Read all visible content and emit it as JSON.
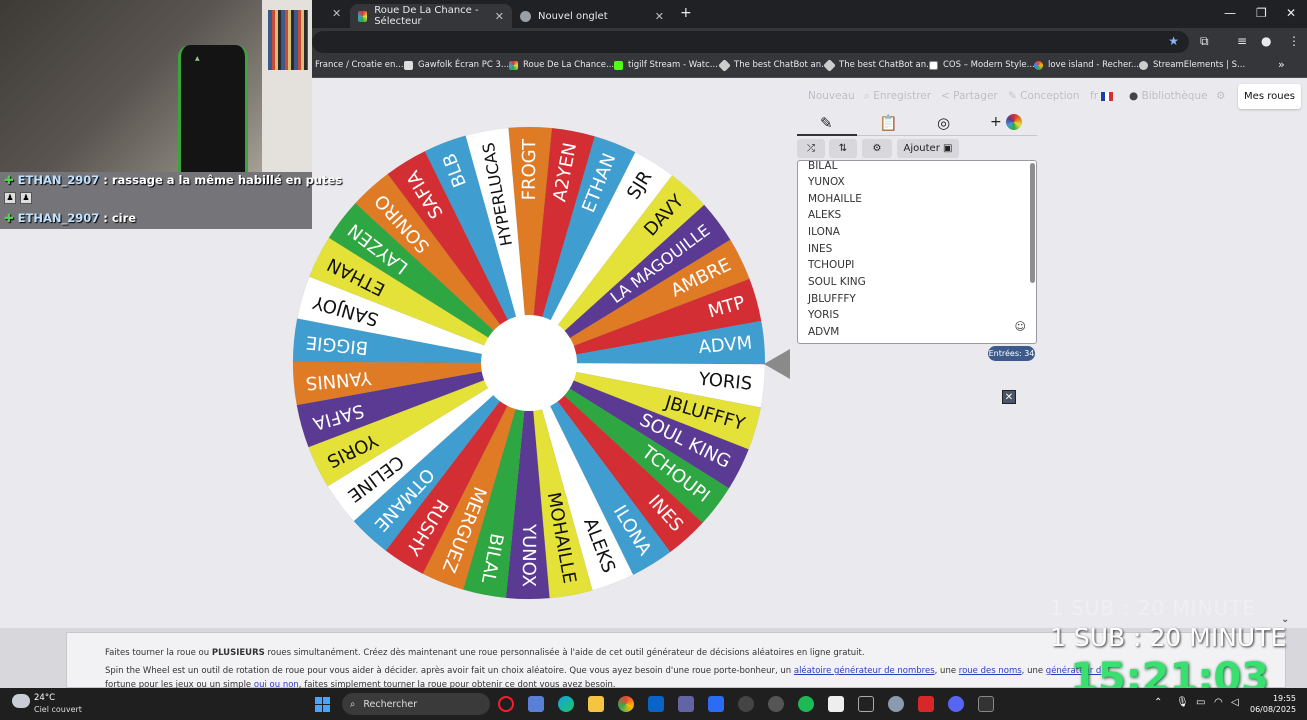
{
  "browser": {
    "tabs": [
      {
        "label": "Roue De La Chance - Sélecteur",
        "active": true
      },
      {
        "label": "Nouvel onglet",
        "active": false
      }
    ],
    "new_tab": "+",
    "bookmarks": [
      "France / Croatie en...",
      "Gawfolk Écran PC 3...",
      "Roue De La Chance...",
      "tigilf Stream - Watc...",
      "The best ChatBot an...",
      "The best ChatBot an...",
      "COS – Modern Style...",
      "love island - Recher...",
      "StreamElements | S..."
    ],
    "more": "»"
  },
  "header": {
    "menu": [
      "Nouveau",
      "Enregistrer",
      "Partager",
      "Conception",
      "fr",
      "Bibliothèque"
    ],
    "mes_roues": "Mes roues"
  },
  "wheel": {
    "segments": [
      {
        "label": "FROGT",
        "color": "#e07b25"
      },
      {
        "label": "A2YEN",
        "color": "#d42e35"
      },
      {
        "label": "ETHAN",
        "color": "#3f9ecf"
      },
      {
        "label": "SJR",
        "color": "#ffffff"
      },
      {
        "label": "DAVY",
        "color": "#e4e238"
      },
      {
        "label": "LA MAGOUILLE",
        "color": "#5a3a93"
      },
      {
        "label": "AMBRE",
        "color": "#e07b25"
      },
      {
        "label": "MTP",
        "color": "#d42e35"
      },
      {
        "label": "ADVM",
        "color": "#3f9ecf"
      },
      {
        "label": "YORIS",
        "color": "#ffffff"
      },
      {
        "label": "JBLUFFFY",
        "color": "#e4e238"
      },
      {
        "label": "SOUL KING",
        "color": "#5a3a93"
      },
      {
        "label": "TCHOUPI",
        "color": "#2ea641"
      },
      {
        "label": "INES",
        "color": "#d42e35"
      },
      {
        "label": "ILONA",
        "color": "#3f9ecf"
      },
      {
        "label": "ALEKS",
        "color": "#ffffff"
      },
      {
        "label": "MOHAILLE",
        "color": "#e4e238"
      },
      {
        "label": "YUNOX",
        "color": "#5a3a93"
      },
      {
        "label": "BILAL",
        "color": "#2ea641"
      },
      {
        "label": "MERGUEZ",
        "color": "#e07b25"
      },
      {
        "label": "RUSHY",
        "color": "#d42e35"
      },
      {
        "label": "OTMANE",
        "color": "#3f9ecf"
      },
      {
        "label": "CELINE",
        "color": "#ffffff"
      },
      {
        "label": "YORIS",
        "color": "#e4e238"
      },
      {
        "label": "SAFIA",
        "color": "#5a3a93"
      },
      {
        "label": "YANNIS",
        "color": "#e07b25"
      },
      {
        "label": "BIGGIE",
        "color": "#3f9ecf"
      },
      {
        "label": "SANJOY",
        "color": "#ffffff"
      },
      {
        "label": "ETHAN",
        "color": "#e4e238"
      },
      {
        "label": "LAYZEN",
        "color": "#2ea641"
      },
      {
        "label": "SONIRO",
        "color": "#e07b25"
      },
      {
        "label": "SAFIA",
        "color": "#d42e35"
      },
      {
        "label": "BLB",
        "color": "#3f9ecf"
      },
      {
        "label": "HYPERLUCAS",
        "color": "#ffffff"
      }
    ]
  },
  "panel": {
    "tab_icons": [
      "pencil-icon",
      "clipboard-icon",
      "eye-slash-icon"
    ],
    "add_label": "+",
    "shuffle": "⤮",
    "sort": "⇅",
    "settings": "⚙",
    "ajouter": "Ajouter",
    "entries": [
      "BILAL",
      "YUNOX",
      "MOHAILLE",
      "ALEKS",
      "ILONA",
      "INES",
      "TCHOUPI",
      "SOUL KING",
      "JBLUFFFY",
      "YORIS",
      "ADVM"
    ],
    "entry_count": "Entrées: 34",
    "close": "✕"
  },
  "chat": {
    "line1_user": "ETHAN_2907",
    "line1_text": ": rassage a la même habillé en putes",
    "line2_user": "ETHAN_2907",
    "line2_text": ": cire"
  },
  "footer": {
    "line1_pre": "Faites tourner la roue ou ",
    "line1_bold": "PLUSIEURS",
    "line1_post": " roues simultanément. Créez dès maintenant une roue personnalisée à l'aide de cet outil générateur de décisions aléatoires en ligne gratuit.",
    "line2_pre": "Spin the Wheel est un outil de rotation de roue pour vous aider à décider. après avoir fait un choix aléatoire. Que vous ayez besoin d'une roue porte-bonheur, un ",
    "line2_link1": "aléatoire générateur de nombres",
    "line2_mid": ", une ",
    "line2_link2": "roue des noms",
    "line2_mid2": ", une ",
    "line2_link3": "générateur d",
    "line3_pre": "fortune pour les jeux ou un simple ",
    "line3_link": "oui ou non",
    "line3_post": ", faites simplement tourner la roue pour obtenir ce dont vous avez besoin."
  },
  "overlay": {
    "sub_ghost": "1 SUB : 20 MINUTE",
    "sub_text": "1 SUB :  20 MINUTE",
    "timer": "15:21:03"
  },
  "taskbar": {
    "temp": "24°C",
    "weather": "Ciel couvert",
    "search": "Rechercher",
    "time": "19:55",
    "date": "06/08/2025"
  }
}
